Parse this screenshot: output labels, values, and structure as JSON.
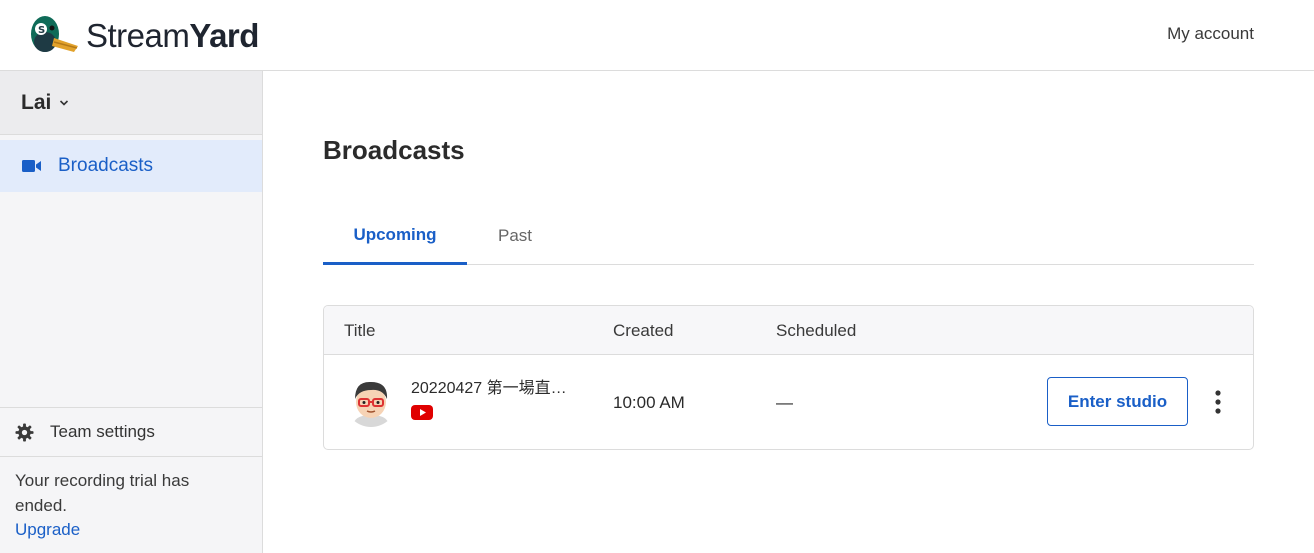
{
  "header": {
    "brand_light": "Stream",
    "brand_bold": "Yard",
    "my_account": "My account"
  },
  "sidebar": {
    "team_name": "Lai",
    "nav": [
      {
        "label": "Broadcasts",
        "icon": "video-camera-icon",
        "active": true
      }
    ],
    "team_settings": "Team settings",
    "trial_message": "Your recording trial has ended.",
    "upgrade_link": "Upgrade"
  },
  "main": {
    "title": "Broadcasts",
    "tabs": [
      {
        "label": "Upcoming",
        "active": true
      },
      {
        "label": "Past",
        "active": false
      }
    ],
    "table": {
      "columns": [
        "Title",
        "Created",
        "Scheduled"
      ],
      "rows": [
        {
          "title": "20220427 第一場直…",
          "destination_icon": "youtube-icon",
          "created": "10:00 AM",
          "scheduled": "—",
          "action": "Enter studio"
        }
      ]
    }
  },
  "colors": {
    "accent": "#1a5fc7",
    "active_nav_bg": "#e2ebfb",
    "youtube": "#e00000"
  }
}
